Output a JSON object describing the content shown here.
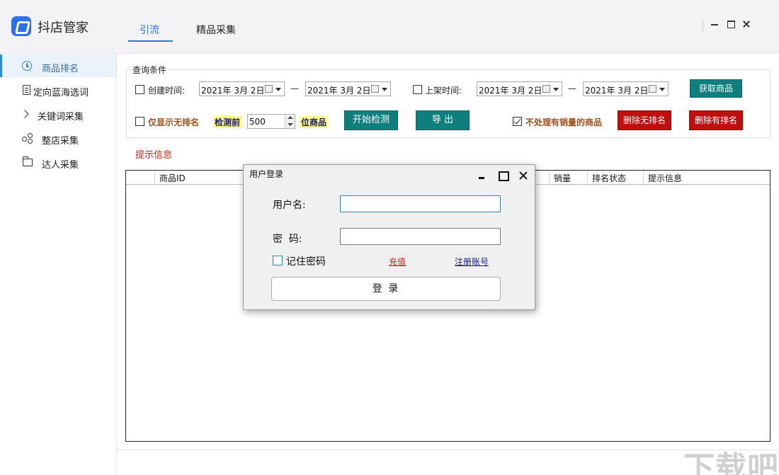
{
  "app": {
    "title": "抖店管家"
  },
  "tabs": [
    {
      "label": "引流",
      "active": true
    },
    {
      "label": "精品采集",
      "active": false
    }
  ],
  "sidebar": {
    "items": [
      {
        "label": "商品排名",
        "icon": "clock-icon",
        "active": true
      },
      {
        "label": "定向蓝海选词",
        "icon": "document-icon",
        "active": false
      },
      {
        "label": "关键词采集",
        "icon": "chevron-right-icon",
        "active": false
      },
      {
        "label": "整店采集",
        "icon": "share-icon",
        "active": false
      },
      {
        "label": "达人采集",
        "icon": "folder-icon",
        "active": false
      }
    ]
  },
  "query": {
    "legend": "查询条件",
    "create_time_label": "创建时间:",
    "create_from": "2021年 3月 2日",
    "create_to": "2021年 3月 2日",
    "list_time_label": "上架时间:",
    "list_from": "2021年 3月 2日",
    "list_to": "2021年 3月 2日",
    "dash": "—",
    "fetch_button": "获取商品",
    "only_unranked_label": "仅显示无排名",
    "check_prefix": "检测前",
    "check_count": "500",
    "check_suffix": "位商品",
    "start_button": "开始检测",
    "export_button": "导 出",
    "skip_sold_label": "不处理有销量的商品",
    "skip_sold_checked": true,
    "delete_unranked_button": "删除无排名",
    "delete_ranked_button": "删除有排名"
  },
  "hint_label": "提示信息",
  "table": {
    "columns": [
      "商品ID",
      "销量",
      "排名状态",
      "提示信息"
    ]
  },
  "dialog": {
    "title": "用户登录",
    "username_label": "用户名:",
    "username_value": "",
    "password_label": "密  码:",
    "password_value": "",
    "remember_label": "记住密码",
    "recharge_link": "充值",
    "register_link": "注册账号",
    "login_button": "登 录"
  },
  "colors": {
    "accent": "#2f78d8",
    "teal_button": "#0e7f7c",
    "red_button": "#c00d0d",
    "hint_text": "#c02a1a",
    "highlight": "#ffff88"
  }
}
